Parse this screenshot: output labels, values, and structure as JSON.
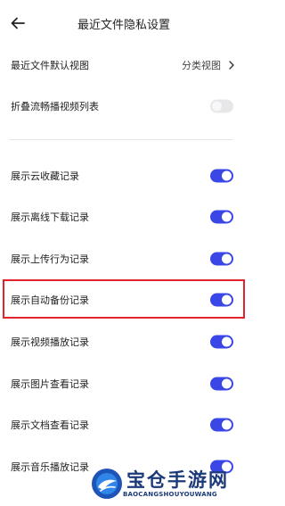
{
  "header": {
    "title": "最近文件隐私设置",
    "back_icon": "arrow-left-icon"
  },
  "rows": [
    {
      "label": "最近文件默认视图",
      "value": "分类视图"
    },
    {
      "label": "折叠流畅播视频列表",
      "toggle": "off"
    },
    {
      "label": "展示云收藏记录",
      "toggle": "on"
    },
    {
      "label": "展示离线下载记录",
      "toggle": "on"
    },
    {
      "label": "展示上传行为记录",
      "toggle": "on"
    },
    {
      "label": "展示自动备份记录",
      "toggle": "on"
    },
    {
      "label": "展示视频播放记录",
      "toggle": "on"
    },
    {
      "label": "展示图片查看记录",
      "toggle": "on"
    },
    {
      "label": "展示文档查看记录",
      "toggle": "on"
    },
    {
      "label": "展示音乐播放记录",
      "toggle": "on"
    }
  ],
  "watermark": {
    "name": "宝仓手游网",
    "domain": "BAOCANGSHOUYOUWANG"
  },
  "colors": {
    "toggle_on": "#3a47e6",
    "toggle_off": "#e7e7ea",
    "highlight": "#e0242a",
    "watermark": "#1c3a7a"
  }
}
